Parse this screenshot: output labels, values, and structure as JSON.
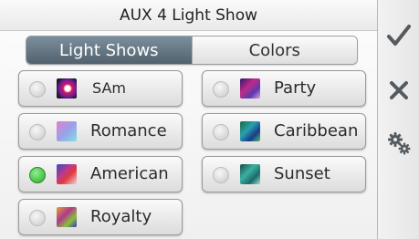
{
  "header": {
    "title": "AUX 4 Light Show"
  },
  "tabs": [
    {
      "label": "Light Shows",
      "active": true
    },
    {
      "label": "Colors",
      "active": false
    }
  ],
  "shows": [
    {
      "label": "SAm",
      "selected": false
    },
    {
      "label": "Party",
      "selected": false
    },
    {
      "label": "Romance",
      "selected": false
    },
    {
      "label": "Caribbean",
      "selected": false
    },
    {
      "label": "American",
      "selected": true
    },
    {
      "label": "Sunset",
      "selected": false
    },
    {
      "label": "Royalty",
      "selected": false
    }
  ],
  "sidebar": {
    "icons": [
      "check-icon",
      "close-icon",
      "settings-icon"
    ]
  },
  "colors": {
    "tab_active": "#5e6f7b",
    "radio_selected": "#2aa82a"
  }
}
